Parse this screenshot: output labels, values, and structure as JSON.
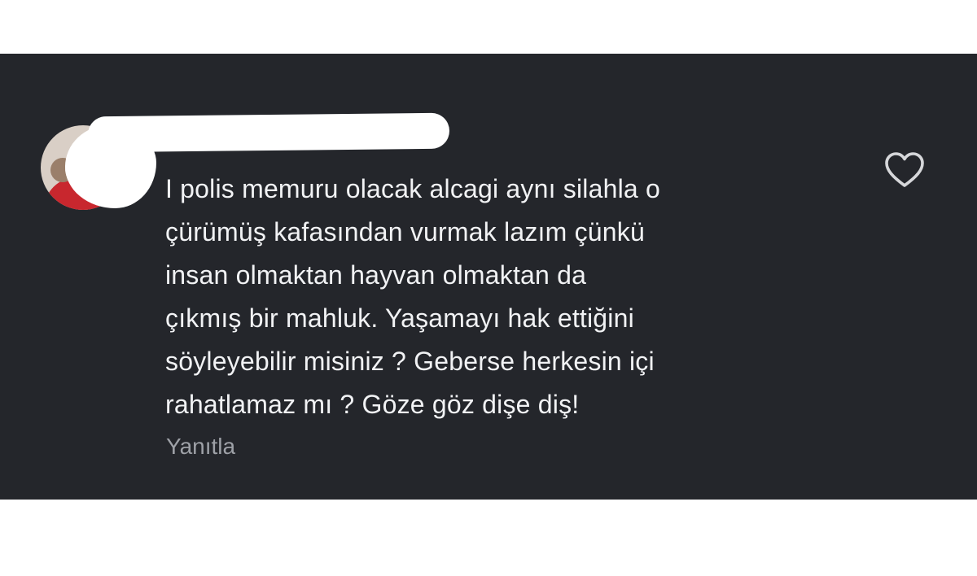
{
  "comment": {
    "text": "I polis memuru olacak alcagi aynı silahla o\nçürümüş kafasından vurmak lazım çünkü\ninsan olmaktan hayvan olmaktan da\nçıkmış bir mahluk. Yaşamayı hak ettiğini\nsöyleyebilir misiniz ? Geberse herkesin içi\nrahatlamaz mı ? Göze göz dişe diş!",
    "reply_label": "Yanıtla",
    "like_icon": "heart-outline-icon"
  },
  "colors": {
    "card_background": "#24262b",
    "text": "#f1f2f4",
    "secondary_text": "#9ea1a7",
    "icon": "#d6d7da"
  }
}
